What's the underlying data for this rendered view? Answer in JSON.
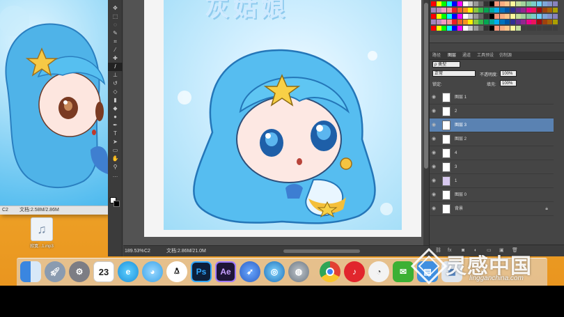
{
  "preview_window": {
    "status_left": "C2",
    "status_doc": "文档:2.58M/2.86M"
  },
  "desktop_file": {
    "name": "寂寞...1.mp3"
  },
  "photoshop": {
    "art_title": "灰姑娘",
    "zoom": "189.53%",
    "status_doc": "文档:2.86M/21.0M",
    "status_left_icon": "C2"
  },
  "layers_panel": {
    "tabs": [
      "路径",
      "图层",
      "通道",
      "工具预设",
      "仿制源"
    ],
    "active_tab": "图层",
    "kind_label": "ρ 类型",
    "blend_mode": "正常",
    "opacity_label": "不透明度:",
    "opacity_value": "100%",
    "lock_label": "锁定:",
    "fill_label": "填充:",
    "fill_value": "100%",
    "layers": [
      {
        "name": "图层 1",
        "selected": false
      },
      {
        "name": "2",
        "selected": false
      },
      {
        "name": "图层 3",
        "selected": true
      },
      {
        "name": "图层 2",
        "selected": false
      },
      {
        "name": "4",
        "selected": false
      },
      {
        "name": "3",
        "selected": false
      },
      {
        "name": "1",
        "selected": false
      },
      {
        "name": "图层 0",
        "selected": false
      },
      {
        "name": "背景",
        "selected": false
      }
    ]
  },
  "dock": {
    "calendar_day": "23",
    "apps": [
      "finder-icon",
      "launchpad-icon",
      "system-preferences-icon",
      "calendar-icon",
      "qq-browser-icon",
      "qq-pet-icon",
      "qq-icon",
      "photoshop-icon",
      "after-effects-icon",
      "rocket-icon",
      "internet-icon",
      "disk-utility-icon",
      "chrome-icon",
      "netease-music-icon",
      "speedometer-icon",
      "wechat-icon",
      "app-icon",
      "files-icon"
    ],
    "ps_label": "Ps",
    "ae_label": "Ae"
  },
  "watermark": {
    "cn": "灵感中国",
    "en": "lingganchina.com"
  }
}
